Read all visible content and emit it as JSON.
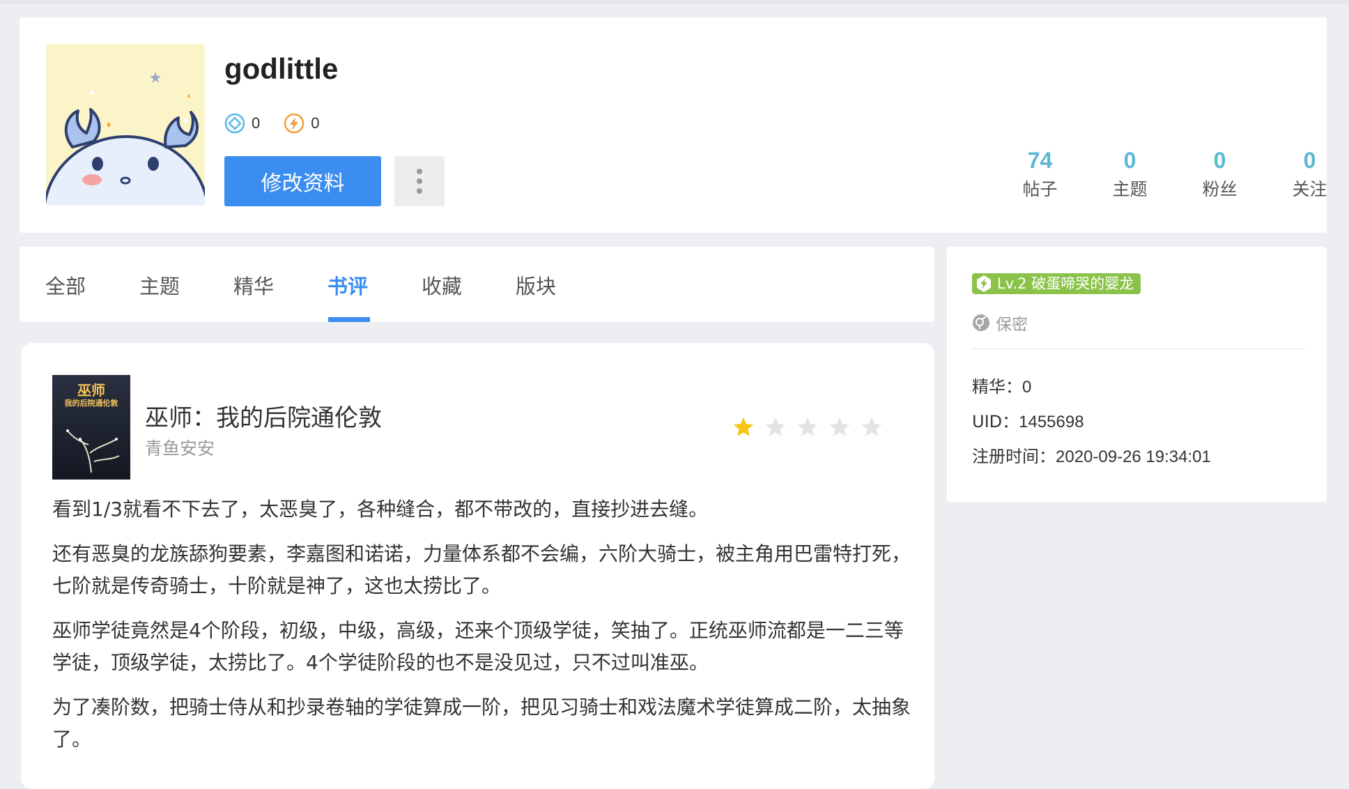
{
  "profile": {
    "username": "godlittle",
    "coins": [
      {
        "icon": "diamond-coin-icon",
        "value": "0"
      },
      {
        "icon": "bolt-coin-icon",
        "value": "0"
      }
    ],
    "edit_label": "修改资料",
    "stats": [
      {
        "value": "74",
        "label": "帖子"
      },
      {
        "value": "0",
        "label": "主题"
      },
      {
        "value": "0",
        "label": "粉丝"
      },
      {
        "value": "0",
        "label": "关注"
      }
    ]
  },
  "tabs": [
    {
      "label": "全部"
    },
    {
      "label": "主题"
    },
    {
      "label": "精华"
    },
    {
      "label": "书评",
      "active": true
    },
    {
      "label": "收藏"
    },
    {
      "label": "版块"
    }
  ],
  "review": {
    "cover_title": "巫师",
    "cover_subtitle": "我的后院通伦敦",
    "book_title": "巫师：我的后院通伦敦",
    "author": "青鱼安安",
    "rating": 1,
    "max_rating": 5,
    "paragraphs": [
      "看到1/3就看不下去了，太恶臭了，各种缝合，都不带改的，直接抄进去缝。",
      "还有恶臭的龙族舔狗要素，李嘉图和诺诺，力量体系都不会编，六阶大骑士，被主角用巴雷特打死，七阶就是传奇骑士，十阶就是神了，这也太捞比了。",
      "巫师学徒竟然是4个阶段，初级，中级，高级，还来个顶级学徒，笑抽了。正统巫师流都是一二三等学徒，顶级学徒，太捞比了。4个学徒阶段的也不是没见过，只不过叫准巫。",
      "为了凑阶数，把骑士侍从和抄录卷轴的学徒算成一阶，把见习骑士和戏法魔术学徒算成二阶，太抽象了。"
    ]
  },
  "sidebar": {
    "level": "Lv.2 破蛋啼哭的婴龙",
    "gender": "保密",
    "featured_label": "精华：",
    "featured_value": "0",
    "uid_label": "UID：",
    "uid_value": "1455698",
    "reg_label": "注册时间：",
    "reg_value": "2020-09-26 19:34:01"
  },
  "colors": {
    "accent": "#3b8df0",
    "stat": "#5bb8d4",
    "level_badge": "#8bc34a",
    "star_on": "#f5c518",
    "star_off": "#e4e4e4"
  }
}
